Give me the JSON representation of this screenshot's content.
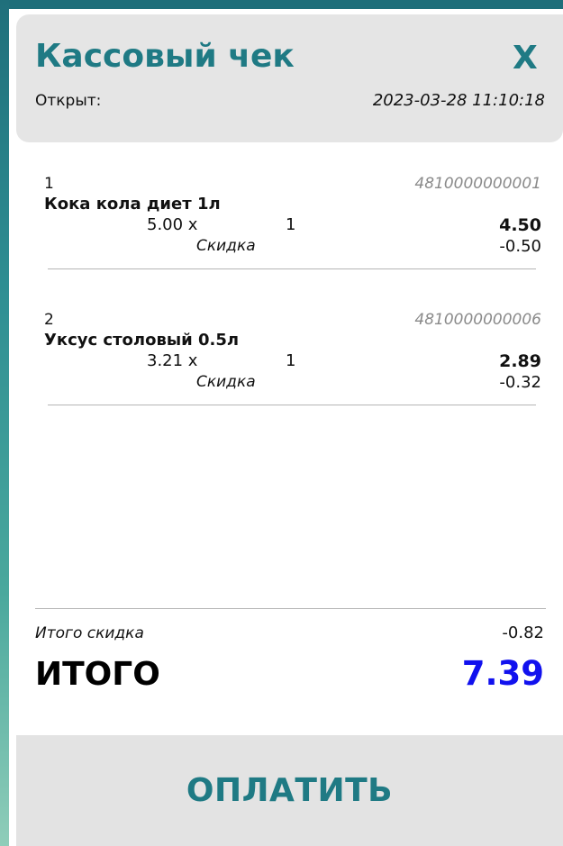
{
  "header": {
    "title": "Кассовый чек",
    "close_label": "X",
    "opened_label": "Открыт:",
    "opened_time": "2023-03-28 11:10:18"
  },
  "items": [
    {
      "number": "1",
      "code": "4810000000001",
      "name": "Кока кола диет 1л",
      "price": "5.00 x",
      "qty": "1",
      "total": "4.50",
      "discount_label": "Скидка",
      "discount": "-0.50"
    },
    {
      "number": "2",
      "code": "4810000000006",
      "name": "Уксус столовый 0.5л",
      "price": "3.21 x",
      "qty": "1",
      "total": "2.89",
      "discount_label": "Скидка",
      "discount": "-0.32"
    }
  ],
  "summary": {
    "discount_label": "Итого скидка",
    "discount": "-0.82",
    "total_label": "ИТОГО",
    "total": "7.39"
  },
  "actions": {
    "pay_label": "ОПЛАТИТЬ"
  },
  "colors": {
    "accent": "#1f7a84",
    "total": "#1111ee",
    "panel_bg": "#e5e5e5"
  }
}
